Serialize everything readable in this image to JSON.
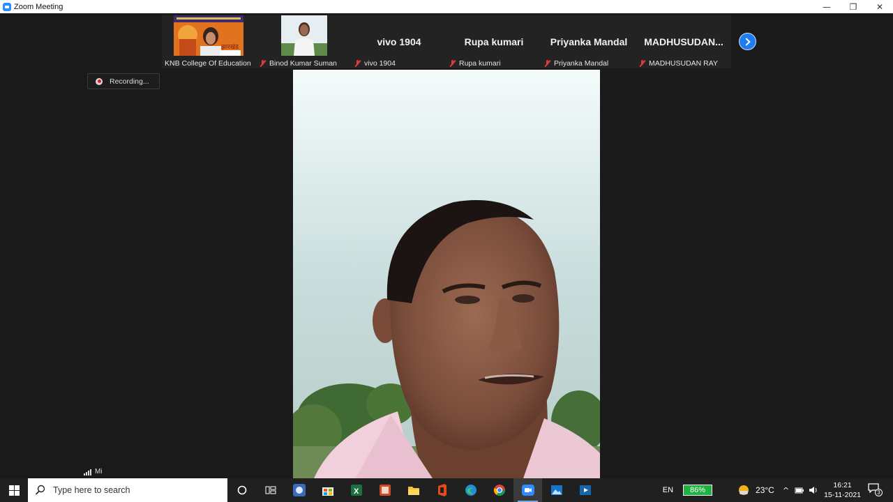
{
  "window": {
    "title": "Zoom Meeting",
    "controls": [
      "—",
      "❐",
      "✕"
    ]
  },
  "participants": [
    {
      "label": "KNB College Of Education",
      "muted": false,
      "has_video": true
    },
    {
      "label": "Binod Kumar Suman",
      "muted": true,
      "has_video": true
    },
    {
      "big_name": "vivo 1904",
      "label": "vivo 1904",
      "muted": true
    },
    {
      "big_name": "Rupa kumari",
      "label": "Rupa kumari",
      "muted": true
    },
    {
      "big_name": "Priyanka Mandal",
      "label": "Priyanka Mandal",
      "muted": true
    },
    {
      "big_name": "MADHUSUDAN...",
      "label": "MADHUSUDAN RAY",
      "muted": true
    }
  ],
  "thumb_banner_text": "झारखंड",
  "recording": {
    "label": "Recording..."
  },
  "signal": {
    "label": "Mi"
  },
  "taskbar": {
    "search_placeholder": "Type here to search",
    "icons": [
      "cortana-icon",
      "task-view-icon",
      "app-icon",
      "store-icon",
      "excel-icon",
      "powerpoint-icon",
      "file-explorer-icon",
      "office-icon",
      "edge-icon",
      "chrome-icon",
      "zoom-icon",
      "photos-icon",
      "media-icon"
    ],
    "active_icon": "zoom-icon",
    "language": "EN",
    "battery": "86%",
    "temperature": "23°C",
    "time": "16:21",
    "date": "15-11-2021",
    "notifications": "3"
  },
  "colors": {
    "zoom_blue": "#2d8cff",
    "mute_red": "#e33b3b",
    "battery_green": "#1fb141"
  }
}
